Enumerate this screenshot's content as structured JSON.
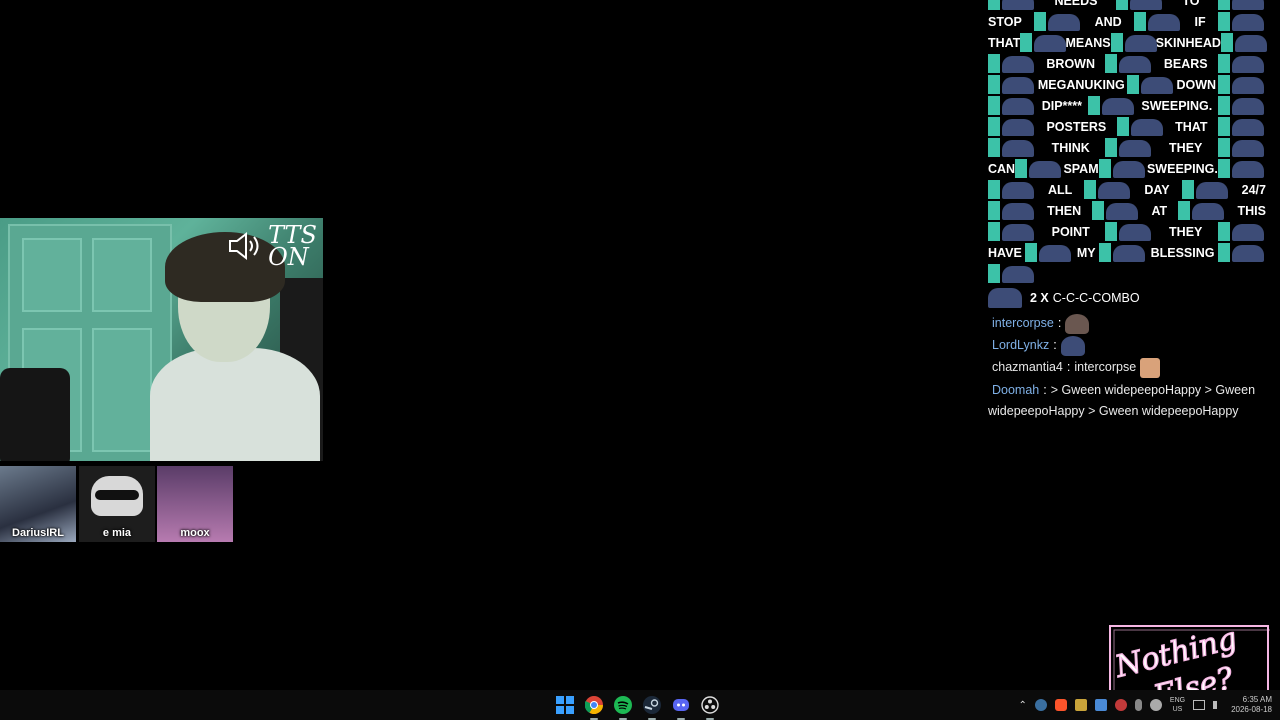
{
  "webcam": {
    "overlay_line1": "TTS",
    "overlay_line2": "ON"
  },
  "participants": [
    {
      "name": "DariusIRL"
    },
    {
      "name": "e mia"
    },
    {
      "name": "moox"
    }
  ],
  "chat": {
    "spam_lines": [
      [
        "",
        "NEEDS",
        "TO",
        ""
      ],
      [
        "STOP",
        "AND",
        "IF",
        ""
      ],
      [
        "THAT",
        "MEANS",
        "SKINHEAD",
        ""
      ],
      [
        "",
        "BROWN",
        "BEARS",
        ""
      ],
      [
        "",
        "MEGANUKING",
        "DOWN",
        ""
      ],
      [
        "",
        "DIP****",
        "SWEEPING.",
        ""
      ],
      [
        "",
        "POSTERS",
        "THAT",
        ""
      ],
      [
        "",
        "THINK",
        "THEY",
        ""
      ],
      [
        "CAN",
        "SPAM",
        "SWEEPING.",
        ""
      ],
      [
        "",
        "ALL",
        "DAY",
        "24/7"
      ],
      [
        "",
        "THEN",
        "AT",
        "THIS"
      ],
      [
        "",
        "POINT",
        "THEY",
        ""
      ],
      [
        "HAVE",
        "MY",
        "BLESSING",
        ""
      ],
      [
        "",
        "",
        "",
        ""
      ]
    ],
    "combo_count": "2 X",
    "combo_text": "C-C-C-COMBO",
    "messages": [
      {
        "user": "intercorpse",
        "sep": ":",
        "body": "",
        "user_color": "#7fb0e6"
      },
      {
        "user": "LordLynkz",
        "sep": ":",
        "body": "",
        "user_color": "#7fb0e6"
      },
      {
        "user": "chazmantia4",
        "sep": ":",
        "body": "intercorpse",
        "user_color": "#e6e6e6"
      },
      {
        "user": "Doomah",
        "sep": ":",
        "body": "> Gween widepeepoHappy > Gween",
        "user_color": "#7fb0e6"
      }
    ],
    "continuation": "widepeepoHappy > Gween widepeepoHappy"
  },
  "logo": {
    "line1": "Nothing",
    "line2": "Else?"
  },
  "taskbar": {
    "apps": [
      "start-icon",
      "chrome-icon",
      "spotify-icon",
      "steam-icon",
      "discord-icon",
      "obs-icon"
    ],
    "lang_line1": "ENG",
    "lang_line2": "US",
    "time": "6:35 AM",
    "date": "2026-08-18"
  },
  "colors": {
    "accent_teal": "#3cc2a8",
    "emote_blue": "#3d4c77",
    "username_blue": "#7fb0e6",
    "logo_pink": "#f6b7e4"
  }
}
